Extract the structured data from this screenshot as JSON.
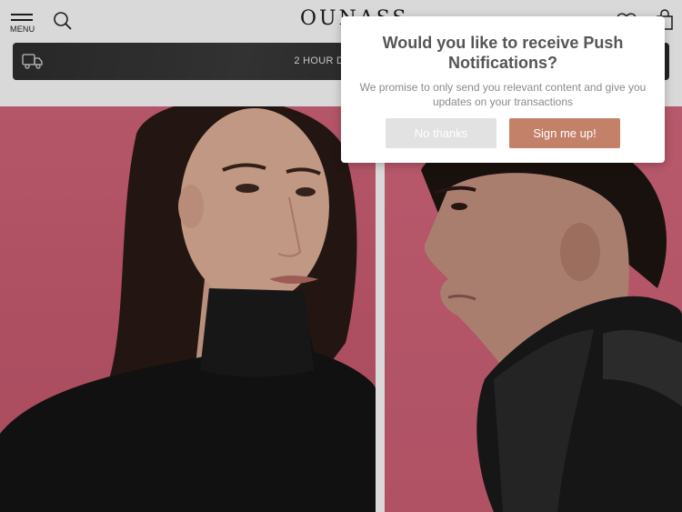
{
  "header": {
    "menu_label": "MENU",
    "logo": "OUNASS"
  },
  "delivery_banner": {
    "text": "2 HOUR DELIVERY"
  },
  "push_prompt": {
    "title": "Would you like to receive Push Notifications?",
    "body": "We promise to only send you relevant content and give you updates on your transactions",
    "decline_label": "No thanks",
    "accept_label": "Sign me up!"
  },
  "colors": {
    "accent": "#c4816a",
    "hero_background": "#d5657b",
    "banner": "#333333"
  },
  "icons": [
    "menu-icon",
    "search-icon",
    "heart-icon",
    "bag-icon",
    "truck-icon"
  ]
}
